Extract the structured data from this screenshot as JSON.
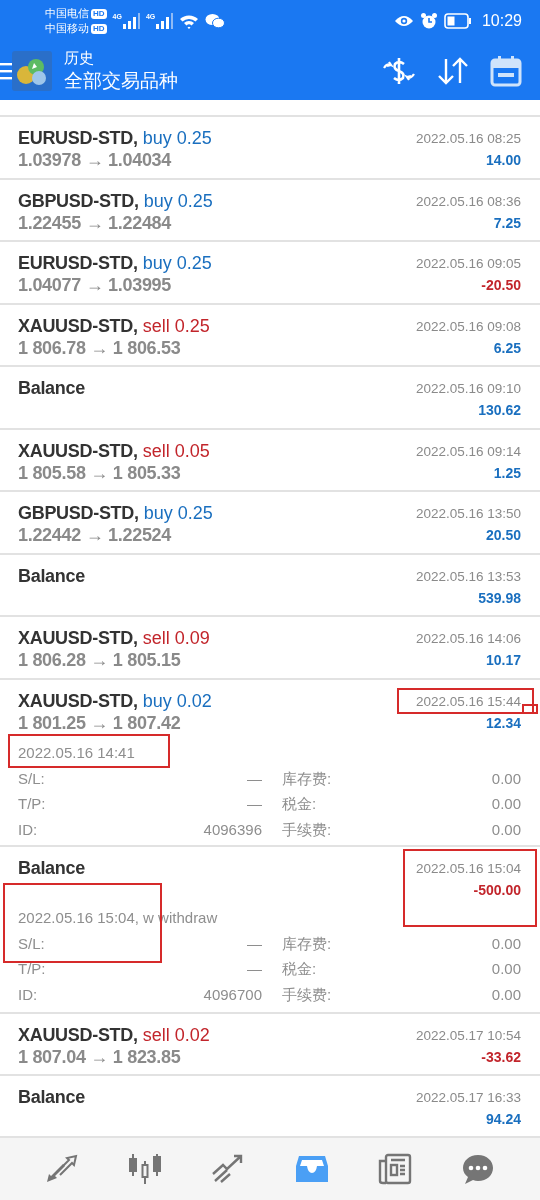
{
  "status_bar": {
    "carriers": [
      {
        "name": "中国电信",
        "badge": "HD"
      },
      {
        "name": "中国移动",
        "badge": "HD"
      }
    ],
    "networks": [
      "4G",
      "4G"
    ],
    "time": "10:29"
  },
  "header": {
    "title": "历史",
    "subtitle": "全部交易品种"
  },
  "deals": [
    {
      "kind": "trade",
      "symbol": "EURUSD-STD,",
      "direction": "buy",
      "volume": "0.25",
      "prices": "1.03978 → 1.04034",
      "time": "2022.05.16 08:25",
      "profit": "14.00",
      "negative": false,
      "expanded": false
    },
    {
      "kind": "trade",
      "symbol": "GBPUSD-STD,",
      "direction": "buy",
      "volume": "0.25",
      "prices": "1.22455 → 1.22484",
      "time": "2022.05.16 08:36",
      "profit": "7.25",
      "negative": false,
      "expanded": false
    },
    {
      "kind": "trade",
      "symbol": "EURUSD-STD,",
      "direction": "buy",
      "volume": "0.25",
      "prices": "1.04077 → 1.03995",
      "time": "2022.05.16 09:05",
      "profit": "-20.50",
      "negative": true,
      "expanded": false
    },
    {
      "kind": "trade",
      "symbol": "XAUUSD-STD,",
      "direction": "sell",
      "volume": "0.25",
      "prices": "1 806.78 → 1 806.53",
      "time": "2022.05.16 09:08",
      "profit": "6.25",
      "negative": false,
      "expanded": false
    },
    {
      "kind": "balance",
      "symbol": "Balance",
      "time": "2022.05.16 09:10",
      "profit": "130.62",
      "negative": false,
      "expanded": false
    },
    {
      "kind": "trade",
      "symbol": "XAUUSD-STD,",
      "direction": "sell",
      "volume": "0.05",
      "prices": "1 805.58 → 1 805.33",
      "time": "2022.05.16 09:14",
      "profit": "1.25",
      "negative": false,
      "expanded": false
    },
    {
      "kind": "trade",
      "symbol": "GBPUSD-STD,",
      "direction": "buy",
      "volume": "0.25",
      "prices": "1.22442 → 1.22524",
      "time": "2022.05.16 13:50",
      "profit": "20.50",
      "negative": false,
      "expanded": false
    },
    {
      "kind": "balance",
      "symbol": "Balance",
      "time": "2022.05.16 13:53",
      "profit": "539.98",
      "negative": false,
      "expanded": false
    },
    {
      "kind": "trade",
      "symbol": "XAUUSD-STD,",
      "direction": "sell",
      "volume": "0.09",
      "prices": "1 806.28 → 1 805.15",
      "time": "2022.05.16 14:06",
      "profit": "10.17",
      "negative": false,
      "expanded": false
    },
    {
      "kind": "trade",
      "symbol": "XAUUSD-STD,",
      "direction": "buy",
      "volume": "0.02",
      "prices": "1 801.25 → 1 807.42",
      "time": "2022.05.16 15:44",
      "profit": "12.34",
      "negative": false,
      "expanded": true,
      "marked_close": true,
      "marked_open": true,
      "marked_edge": true,
      "details": {
        "note": "2022.05.16 14:41",
        "rows": [
          {
            "label": "S/L:",
            "value": "—",
            "label2": "库存费:",
            "value2": "0.00"
          },
          {
            "label": "T/P:",
            "value": "—",
            "label2": "税金:",
            "value2": "0.00"
          },
          {
            "label": "ID:",
            "value": "4096396",
            "label2": "手续费:",
            "value2": "0.00"
          }
        ]
      }
    },
    {
      "kind": "balance",
      "symbol": "Balance",
      "time": "2022.05.16 15:04",
      "profit": "-500.00",
      "negative": true,
      "expanded": true,
      "marked_close": true,
      "marked_open": true,
      "marked_edge": false,
      "details": {
        "note": "2022.05.16 15:04, w withdraw",
        "rows": [
          {
            "label": "S/L:",
            "value": "—",
            "label2": "库存费:",
            "value2": "0.00"
          },
          {
            "label": "T/P:",
            "value": "—",
            "label2": "税金:",
            "value2": "0.00"
          },
          {
            "label": "ID:",
            "value": "4096700",
            "label2": "手续费:",
            "value2": "0.00"
          }
        ]
      }
    },
    {
      "kind": "trade",
      "symbol": "XAUUSD-STD,",
      "direction": "sell",
      "volume": "0.02",
      "prices": "1 807.04 → 1 823.85",
      "time": "2022.05.17 10:54",
      "profit": "-33.62",
      "negative": true,
      "expanded": false
    },
    {
      "kind": "balance",
      "symbol": "Balance",
      "time": "2022.05.17 16:33",
      "profit": "94.24",
      "negative": false,
      "expanded": false
    }
  ],
  "bottom_nav": [
    {
      "kind": "quotes",
      "selected": false
    },
    {
      "kind": "chart",
      "selected": false
    },
    {
      "kind": "trade",
      "selected": false
    },
    {
      "kind": "history",
      "selected": true
    },
    {
      "kind": "news",
      "selected": false
    },
    {
      "kind": "chat",
      "selected": false
    }
  ]
}
